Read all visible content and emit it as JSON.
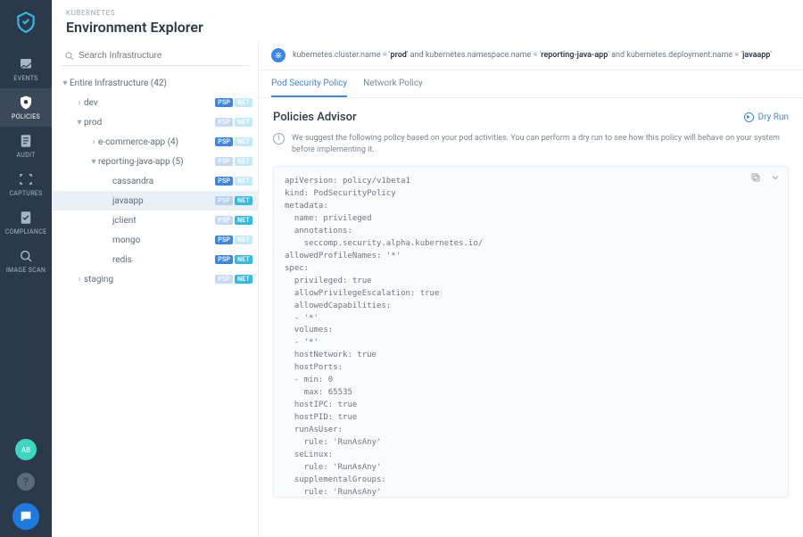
{
  "rail": {
    "items": [
      {
        "label": "EVENTS"
      },
      {
        "label": "POLICIES"
      },
      {
        "label": "AUDIT"
      },
      {
        "label": "CAPTURES"
      },
      {
        "label": "COMPLIANCE"
      },
      {
        "label": "IMAGE SCAN"
      }
    ],
    "avatar": "AB"
  },
  "header": {
    "eyebrow": "KUBERNETES",
    "title": "Environment Explorer"
  },
  "search": {
    "placeholder": "Search Infrastructure"
  },
  "tree": [
    {
      "depth": 0,
      "chev": "▾",
      "label": "Entire Infrastructure (42)",
      "psp": false,
      "net": false
    },
    {
      "depth": 1,
      "chev": "›",
      "label": "dev",
      "psp": true,
      "net": true,
      "netFaded": true
    },
    {
      "depth": 1,
      "chev": "▾",
      "label": "prod",
      "psp": true,
      "net": true,
      "pspFaded": true,
      "netFaded": true
    },
    {
      "depth": 2,
      "chev": "›",
      "label": "e-commerce-app (4)",
      "psp": true,
      "net": true,
      "netFaded": true
    },
    {
      "depth": 2,
      "chev": "▾",
      "label": "reporting-java-app (5)",
      "psp": true,
      "net": true,
      "pspFaded": true,
      "netFaded": true
    },
    {
      "depth": 3,
      "chev": "",
      "label": "cassandra",
      "psp": true,
      "net": true,
      "netFaded": true
    },
    {
      "depth": 3,
      "chev": "",
      "label": "javaapp",
      "psp": true,
      "net": true,
      "pspFaded": true,
      "selected": true
    },
    {
      "depth": 3,
      "chev": "",
      "label": "jclient",
      "psp": true,
      "net": true,
      "pspFaded": true
    },
    {
      "depth": 3,
      "chev": "",
      "label": "mongo",
      "psp": true,
      "net": true,
      "netFaded": true
    },
    {
      "depth": 3,
      "chev": "",
      "label": "redis",
      "psp": true,
      "net": true
    },
    {
      "depth": 1,
      "chev": "›",
      "label": "staging",
      "psp": true,
      "net": true,
      "pspFaded": true
    }
  ],
  "scope": {
    "key1": "kubernetes.cluster.name",
    "val1": "prod",
    "key2": "kubernetes.namespace.name",
    "val2": "reporting-java-app",
    "key3": "kubernetes.deployment.name",
    "val3": "javaapp",
    "and": "and",
    "eq": "="
  },
  "tabs": {
    "t1": "Pod Security Policy",
    "t2": "Network Policy"
  },
  "panel": {
    "title": "Policies Advisor",
    "dryrun": "Dry Run",
    "hint": "We suggest the following policy based on your pod activities. You can perform a dry run to see how this policy will behave on your system before implementing it."
  },
  "badge": {
    "psp": "PSP",
    "net": "NET"
  },
  "code": "apiVersion: policy/v1beta1\nkind: PodSecurityPolicy\nmetadata:\n  name: privileged\n  annotations:\n    seccomp.security.alpha.kubernetes.io/\nallowedProfileNames: '*'\nspec:\n  privileged: true\n  allowPrivilegeEscalation: true\n  allowedCapabilities:\n  - '*'\n  volumes:\n  - '*'\n  hostNetwork: true\n  hostPorts:\n  - min: 0\n    max: 65535\n  hostIPC: true\n  hostPID: true\n  runAsUser:\n    rule: 'RunAsAny'\n  seLinux:\n    rule: 'RunAsAny'\n  supplementalGroups:\n    rule: 'RunAsAny'\n  fsGroup:\n    rule: 'RunAsAny'"
}
